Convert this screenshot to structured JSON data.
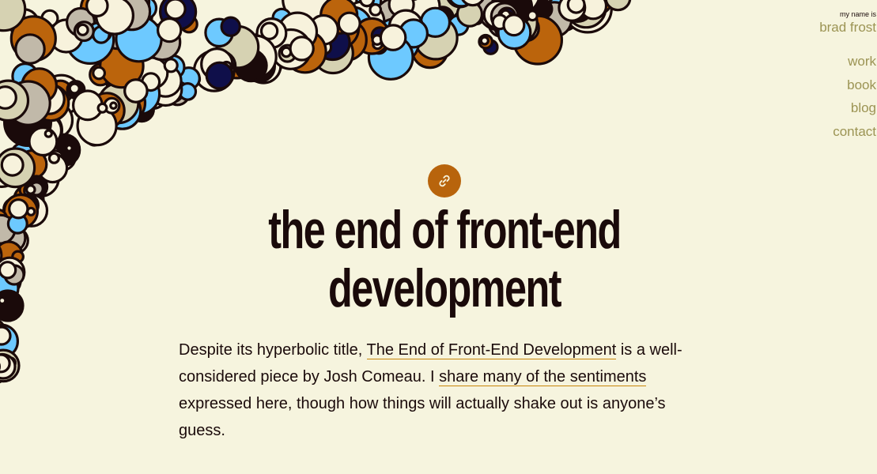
{
  "header": {
    "kicker": "my name is",
    "brand": "brad frost"
  },
  "nav": {
    "items": [
      {
        "label": "work"
      },
      {
        "label": "book"
      },
      {
        "label": "blog"
      },
      {
        "label": "contact"
      }
    ]
  },
  "article": {
    "permalink_icon": "link-icon",
    "title": "the end of front-end development",
    "intro": {
      "text_1": "Despite its hyperbolic title, ",
      "link_1": "The End of Front-End Development",
      "text_2": " is a well-considered piece by Josh Comeau. I ",
      "link_2": "share many of the sentiments",
      "text_3": " expressed here, though how things will actually shake out is anyone’s guess."
    }
  },
  "colors": {
    "background": "#f6f4de",
    "accent": "#9c9454",
    "permalink_badge": "#b8640c",
    "text": "#1a0a0a",
    "link_underline": "#c8860a",
    "bubble_palette": [
      "#f7f2dc",
      "#bb640c",
      "#c1b9a9",
      "#6dc9ff",
      "#0f0f4a",
      "#1a0a0a",
      "#d6d2b2"
    ]
  }
}
